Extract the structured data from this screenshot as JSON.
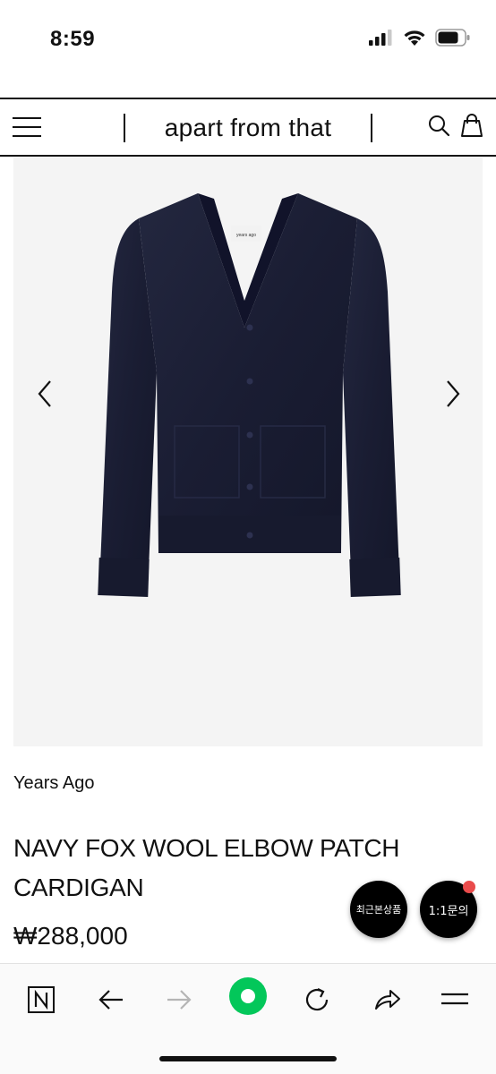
{
  "status_bar": {
    "time": "8:59",
    "icons": [
      "cellular-signal-icon",
      "wifi-icon",
      "battery-icon"
    ]
  },
  "header": {
    "brand": "apart from that",
    "menu_icon": "hamburger-menu-icon",
    "search_icon": "search-icon",
    "cart_icon": "shopping-bag-icon"
  },
  "product": {
    "image_label": "years ago",
    "brand": "Years Ago",
    "title": "NAVY FOX WOOL ELBOW PATCH CARDIGAN",
    "price": "₩288,000",
    "garment_color": "#1a1d33"
  },
  "floating": {
    "recent_label": "최근본상품",
    "inquiry_label": "1:1문의"
  },
  "browser_bar": {
    "icons": [
      "naver-n-icon",
      "back-arrow-icon",
      "forward-arrow-icon",
      "green-home-dot-icon",
      "refresh-icon",
      "share-icon",
      "menu-icon"
    ],
    "accent": "#03c75a"
  }
}
